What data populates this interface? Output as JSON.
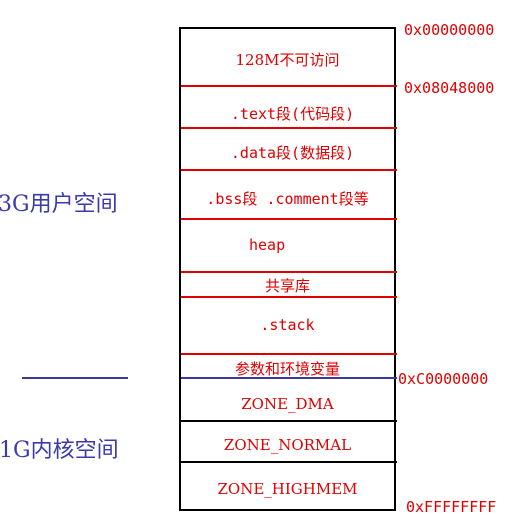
{
  "addresses": {
    "top": "0x00000000",
    "text": "0x08048000",
    "kernel": "0xC0000000",
    "bottom": "0xFFFFFFFF"
  },
  "user_space_label": "3G用户空间",
  "kernel_space_label": "1G内核空间",
  "segments": {
    "unaccessible": "128M不可访问",
    "text": ".text段(代码段)",
    "data": ".data段(数据段)",
    "bss": ".bss段 .comment段等",
    "heap": "heap",
    "shared_lib": "共享库",
    "stack": ".stack",
    "args_env": "参数和环境变量",
    "zone_dma": "ZONE_DMA",
    "zone_normal": "ZONE_NORMAL",
    "zone_highmem": "ZONE_HIGHMEM"
  }
}
